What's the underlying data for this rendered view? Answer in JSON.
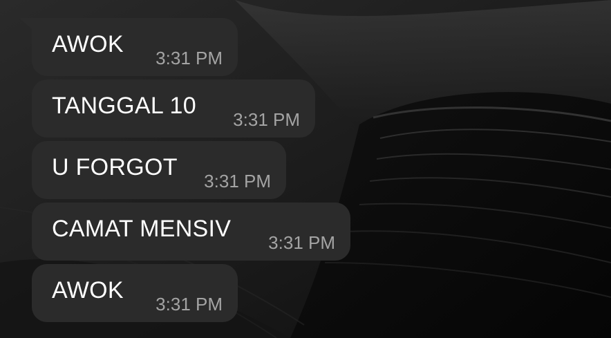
{
  "colors": {
    "bubble_background": "#2b2b2b",
    "message_text": "#ffffff",
    "timestamp_text": "#a4a4a4",
    "wallpaper": "#1a1a1a"
  },
  "messages": [
    {
      "text": "AWOK",
      "time": "3:31 PM"
    },
    {
      "text": "TANGGAL 10",
      "time": "3:31 PM"
    },
    {
      "text": "U FORGOT",
      "time": "3:31 PM"
    },
    {
      "text": "CAMAT MENSIV",
      "time": "3:31 PM"
    },
    {
      "text": "AWOK",
      "time": "3:31 PM"
    }
  ]
}
